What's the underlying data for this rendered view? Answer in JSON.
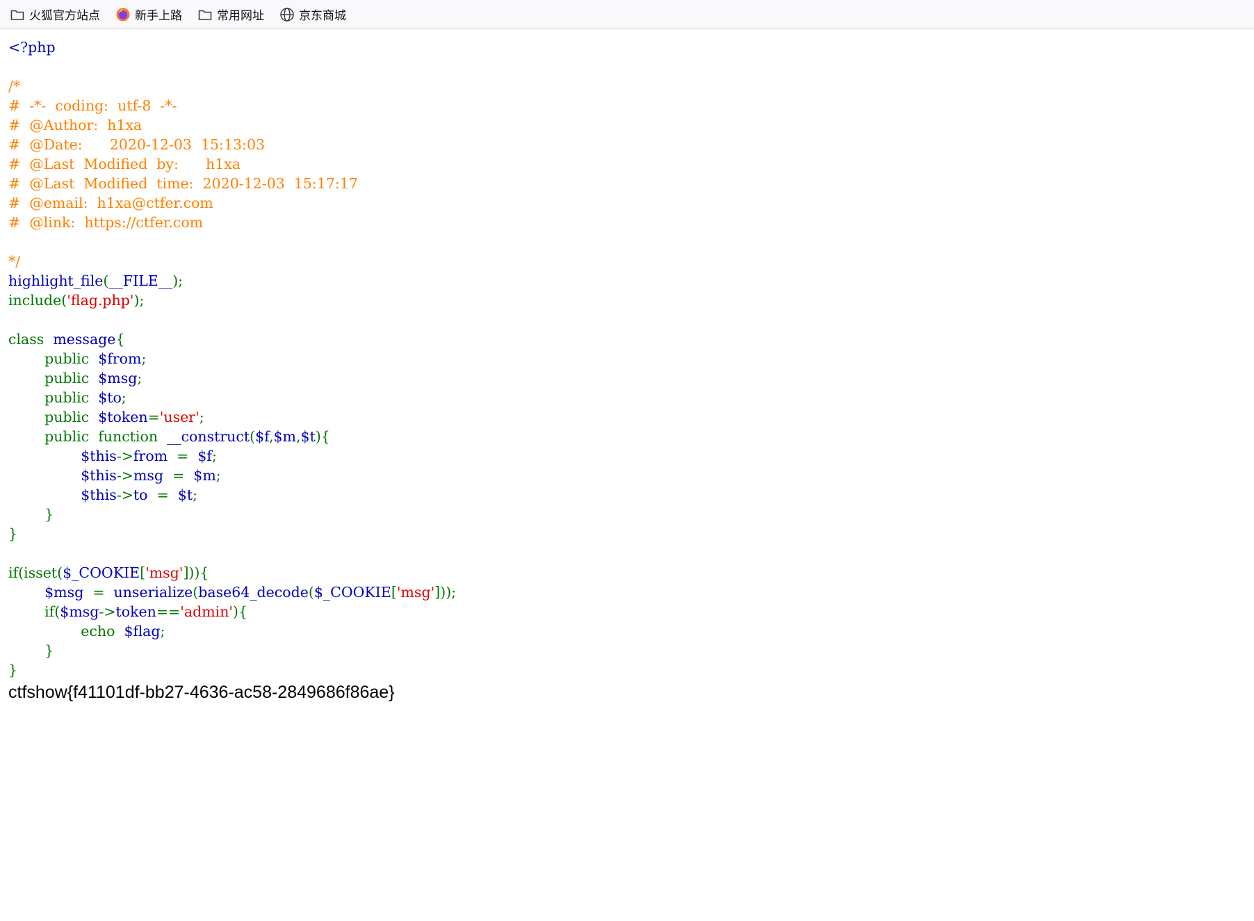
{
  "bookmarks_toolbar": {
    "items": [
      {
        "label": "火狐官方站点",
        "icon": "folder-icon"
      },
      {
        "label": "新手上路",
        "icon": "firefox-icon"
      },
      {
        "label": "常用网址",
        "icon": "folder-icon"
      },
      {
        "label": "京东商城",
        "icon": "globe-icon"
      }
    ]
  },
  "source_colors": {
    "keyword": "#007700",
    "default": "#0000BB",
    "string": "#DD0000",
    "comment": "#FF8000"
  },
  "source_lines": [
    [
      [
        "v",
        "<?php"
      ]
    ],
    [],
    [
      [
        "c",
        "/*"
      ]
    ],
    [
      [
        "c",
        "#  -*-  coding:  utf-8  -*-"
      ]
    ],
    [
      [
        "c",
        "#  @Author:  h1xa"
      ]
    ],
    [
      [
        "c",
        "#  @Date:      2020-12-03  15:13:03"
      ]
    ],
    [
      [
        "c",
        "#  @Last  Modified  by:      h1xa"
      ]
    ],
    [
      [
        "c",
        "#  @Last  Modified  time:  2020-12-03  15:17:17"
      ]
    ],
    [
      [
        "c",
        "#  @email:  h1xa@ctfer.com"
      ]
    ],
    [
      [
        "c",
        "#  @link:  https://ctfer.com"
      ]
    ],
    [],
    [
      [
        "c",
        "*/"
      ]
    ],
    [
      [
        "v",
        "highlight_file"
      ],
      [
        "k",
        "("
      ],
      [
        "v",
        "__FILE__"
      ],
      [
        "k",
        ");"
      ]
    ],
    [
      [
        "k",
        "include("
      ],
      [
        "s",
        "'flag.php'"
      ],
      [
        "k",
        ");"
      ]
    ],
    [],
    [
      [
        "k",
        "class  "
      ],
      [
        "v",
        "message"
      ],
      [
        "k",
        "{"
      ]
    ],
    [
      [
        "k",
        "        public  "
      ],
      [
        "v",
        "$from"
      ],
      [
        "k",
        ";"
      ]
    ],
    [
      [
        "k",
        "        public  "
      ],
      [
        "v",
        "$msg"
      ],
      [
        "k",
        ";"
      ]
    ],
    [
      [
        "k",
        "        public  "
      ],
      [
        "v",
        "$to"
      ],
      [
        "k",
        ";"
      ]
    ],
    [
      [
        "k",
        "        public  "
      ],
      [
        "v",
        "$token"
      ],
      [
        "k",
        "="
      ],
      [
        "s",
        "'user'"
      ],
      [
        "k",
        ";"
      ]
    ],
    [
      [
        "k",
        "        public  function  "
      ],
      [
        "v",
        "__construct"
      ],
      [
        "k",
        "("
      ],
      [
        "v",
        "$f"
      ],
      [
        "k",
        ","
      ],
      [
        "v",
        "$m"
      ],
      [
        "k",
        ","
      ],
      [
        "v",
        "$t"
      ],
      [
        "k",
        "){"
      ]
    ],
    [
      [
        "k",
        "                "
      ],
      [
        "v",
        "$this"
      ],
      [
        "k",
        "->"
      ],
      [
        "v",
        "from  "
      ],
      [
        "k",
        "=  "
      ],
      [
        "v",
        "$f"
      ],
      [
        "k",
        ";"
      ]
    ],
    [
      [
        "k",
        "                "
      ],
      [
        "v",
        "$this"
      ],
      [
        "k",
        "->"
      ],
      [
        "v",
        "msg  "
      ],
      [
        "k",
        "=  "
      ],
      [
        "v",
        "$m"
      ],
      [
        "k",
        ";"
      ]
    ],
    [
      [
        "k",
        "                "
      ],
      [
        "v",
        "$this"
      ],
      [
        "k",
        "->"
      ],
      [
        "v",
        "to  "
      ],
      [
        "k",
        "=  "
      ],
      [
        "v",
        "$t"
      ],
      [
        "k",
        ";"
      ]
    ],
    [
      [
        "k",
        "        }"
      ]
    ],
    [
      [
        "k",
        "}"
      ]
    ],
    [],
    [
      [
        "k",
        "if(isset("
      ],
      [
        "v",
        "$_COOKIE"
      ],
      [
        "k",
        "["
      ],
      [
        "s",
        "'msg'"
      ],
      [
        "k",
        "])){"
      ]
    ],
    [
      [
        "k",
        "        "
      ],
      [
        "v",
        "$msg  "
      ],
      [
        "k",
        "=  "
      ],
      [
        "v",
        "unserialize"
      ],
      [
        "k",
        "("
      ],
      [
        "v",
        "base64_decode"
      ],
      [
        "k",
        "("
      ],
      [
        "v",
        "$_COOKIE"
      ],
      [
        "k",
        "["
      ],
      [
        "s",
        "'msg'"
      ],
      [
        "k",
        "]));"
      ]
    ],
    [
      [
        "k",
        "        if("
      ],
      [
        "v",
        "$msg"
      ],
      [
        "k",
        "->"
      ],
      [
        "v",
        "token"
      ],
      [
        "k",
        "=="
      ],
      [
        "s",
        "'admin'"
      ],
      [
        "k",
        "){"
      ]
    ],
    [
      [
        "k",
        "                echo  "
      ],
      [
        "v",
        "$flag"
      ],
      [
        "k",
        ";"
      ]
    ],
    [
      [
        "k",
        "        }"
      ]
    ],
    [
      [
        "k",
        "}"
      ]
    ]
  ],
  "flag_output": "ctfshow{f41101df-bb27-4636-ac58-2849686f86ae}"
}
